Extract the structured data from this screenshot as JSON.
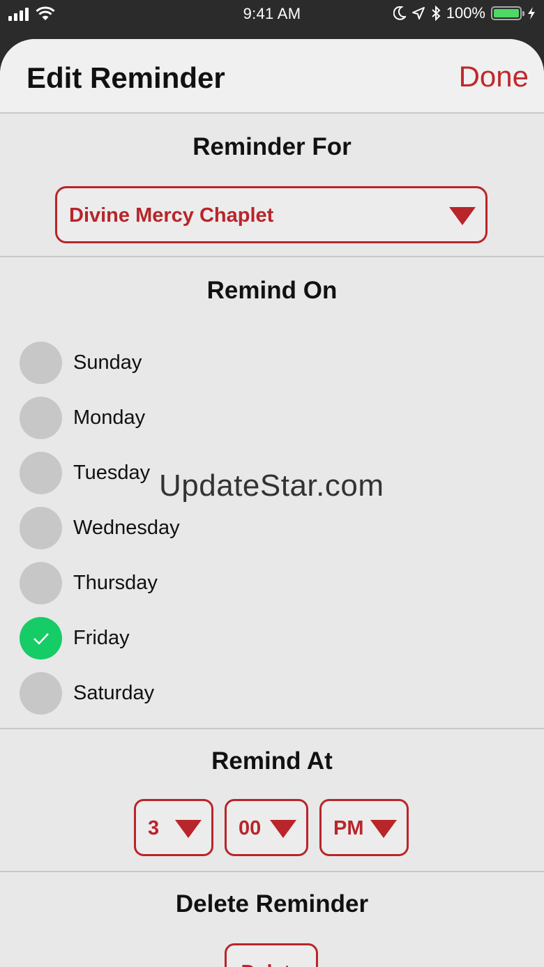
{
  "status_bar": {
    "time": "9:41 AM",
    "battery_text": "100%",
    "icons": [
      "signal-icon",
      "wifi-icon",
      "moon-icon",
      "location-icon",
      "bluetooth-icon",
      "battery-icon",
      "charging-icon"
    ],
    "battery_color": "#4cd964"
  },
  "nav": {
    "title": "Edit Reminder",
    "done_label": "Done"
  },
  "reminder_for": {
    "title": "Reminder For",
    "selected": "Divine Mercy Chaplet"
  },
  "remind_on": {
    "title": "Remind On",
    "days": [
      {
        "label": "Sunday",
        "checked": false
      },
      {
        "label": "Monday",
        "checked": false
      },
      {
        "label": "Tuesday",
        "checked": false
      },
      {
        "label": "Wednesday",
        "checked": false
      },
      {
        "label": "Thursday",
        "checked": false
      },
      {
        "label": "Friday",
        "checked": true
      },
      {
        "label": "Saturday",
        "checked": false
      }
    ]
  },
  "watermark": "UpdateStar.com",
  "remind_at": {
    "title": "Remind At",
    "hour": "3",
    "minute": "00",
    "ampm": "PM"
  },
  "delete_section": {
    "title": "Delete Reminder",
    "button_label": "Delete"
  },
  "colors": {
    "accent": "#b8252a",
    "checked": "#16cc66",
    "unchecked": "#c7c7c7"
  }
}
